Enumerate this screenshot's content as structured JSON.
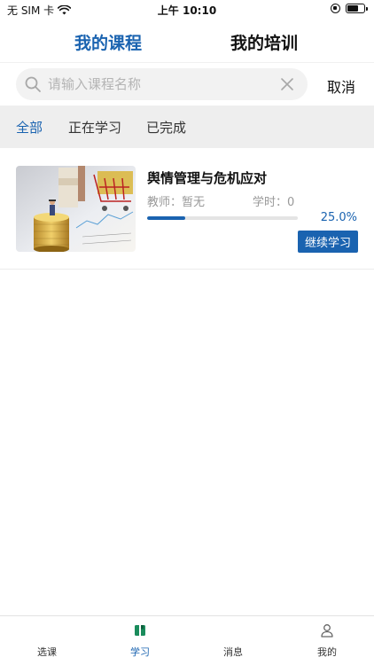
{
  "status_bar": {
    "carrier": "无 SIM 卡",
    "time": "上午 10:10",
    "icons": [
      "wifi-icon",
      "rotation-lock-icon",
      "battery-icon"
    ]
  },
  "top_tabs": {
    "active": "我的课程",
    "inactive": "我的培训"
  },
  "search": {
    "placeholder": "请输入课程名称",
    "value": "",
    "cancel_label": "取消"
  },
  "filters": [
    {
      "label": "全部",
      "active": true
    },
    {
      "label": "正在学习",
      "active": false
    },
    {
      "label": "已完成",
      "active": false
    }
  ],
  "courses": [
    {
      "title": "舆情管理与危机应对",
      "teacher": "教师：暂无",
      "hours": "学时：0",
      "progress_percent": 25.0,
      "progress_text": "25.0%",
      "action_label": "继续学习"
    }
  ],
  "bottom_nav": [
    {
      "label": "选课",
      "icon": "select-course-icon",
      "active": false
    },
    {
      "label": "学习",
      "icon": "book-icon",
      "active": true
    },
    {
      "label": "消息",
      "icon": "message-icon",
      "active": false
    },
    {
      "label": "我的",
      "icon": "user-icon",
      "active": false
    }
  ],
  "colors": {
    "accent": "#1a63b0",
    "filter_bg": "#eeeeee",
    "search_bg": "#f2f2f2",
    "muted_text": "#999999"
  }
}
